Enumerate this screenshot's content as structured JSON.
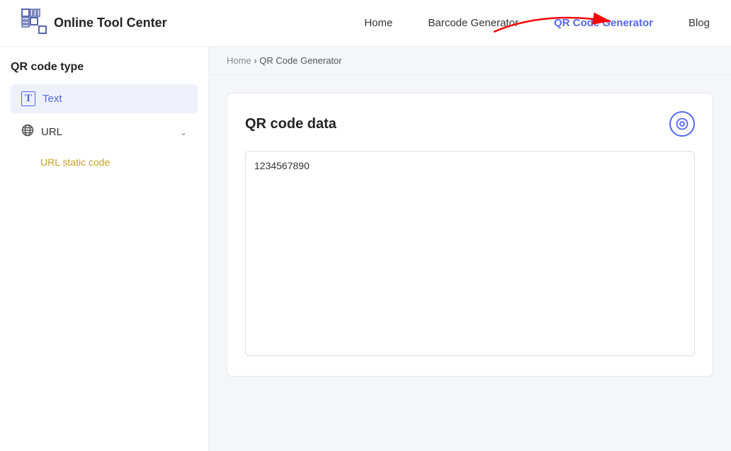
{
  "header": {
    "logo_text": "Online Tool Center",
    "nav": [
      {
        "id": "home",
        "label": "Home",
        "active": false
      },
      {
        "id": "barcode",
        "label": "Barcode Generator",
        "active": false
      },
      {
        "id": "qrcode",
        "label": "QR Code Generator",
        "active": true
      },
      {
        "id": "blog",
        "label": "Blog",
        "active": false
      }
    ]
  },
  "sidebar": {
    "title": "QR code type",
    "items": [
      {
        "id": "text",
        "label": "Text",
        "icon": "T",
        "active": true
      },
      {
        "id": "url",
        "label": "URL",
        "icon": "🌐",
        "active": false
      }
    ],
    "url_static_label": "URL static code"
  },
  "breadcrumb": {
    "home": "Home",
    "separator": "›",
    "current": "QR Code Generator"
  },
  "main": {
    "card_title": "QR code data",
    "textarea_value": "1234567890"
  },
  "colors": {
    "accent": "#5566ee",
    "active_bg": "#eef0fb",
    "gold": "#c8a020"
  }
}
